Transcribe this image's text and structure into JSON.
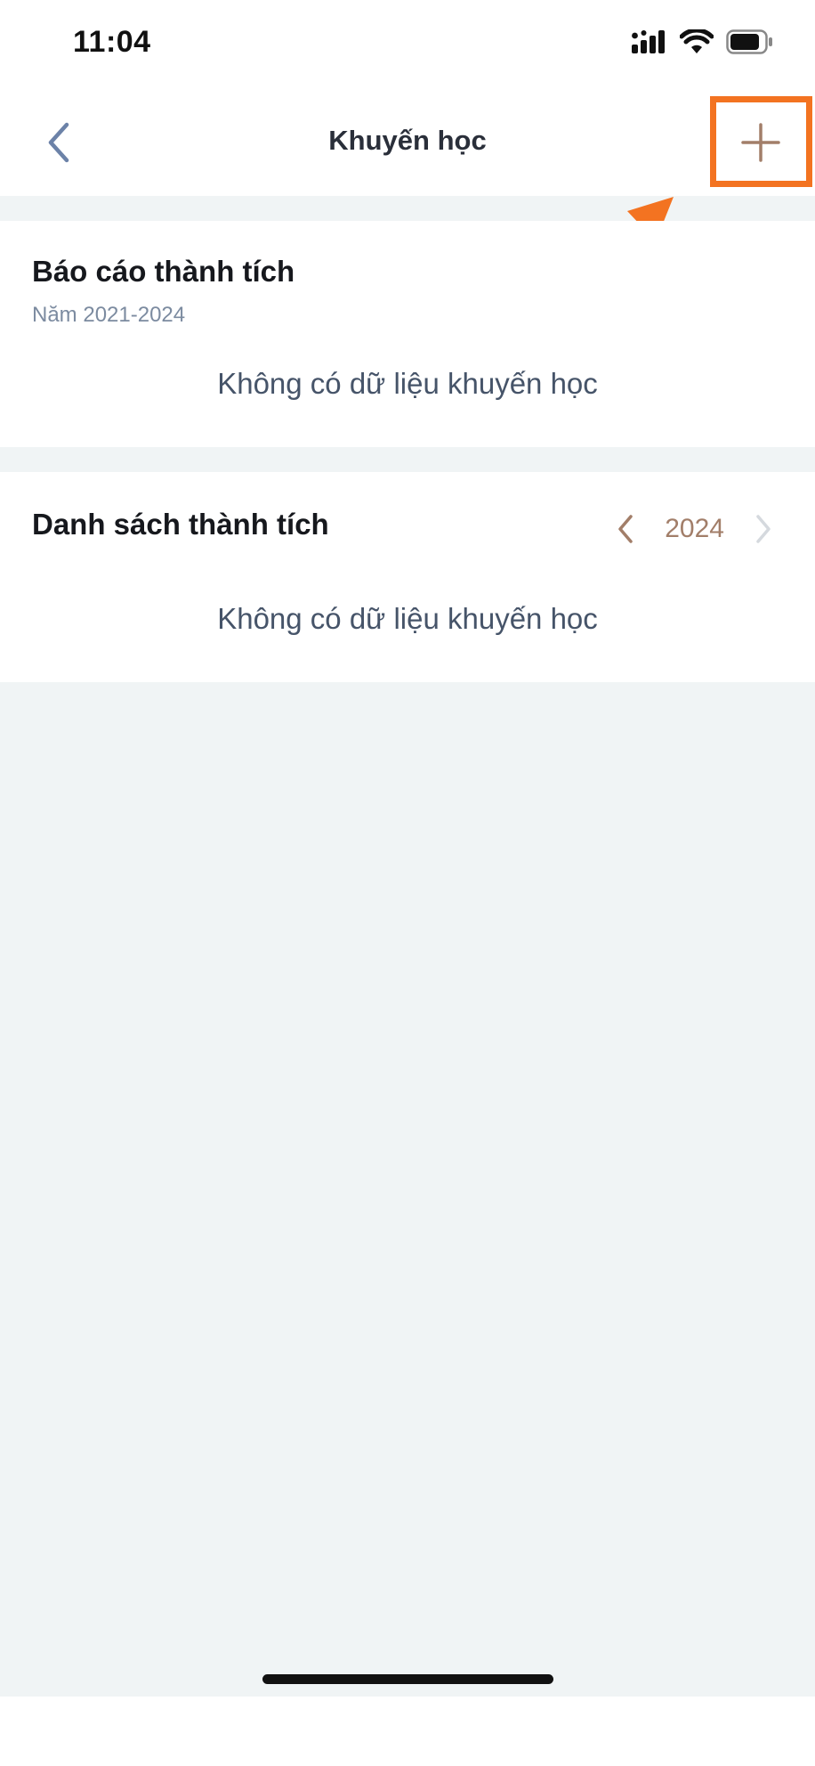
{
  "status_bar": {
    "time": "11:04",
    "icons": [
      "cellular-signal-icon",
      "wifi-icon",
      "battery-icon"
    ]
  },
  "nav": {
    "title": "Khuyến học",
    "back_icon": "chevron-left-icon",
    "add_icon": "plus-icon"
  },
  "report_section": {
    "title": "Báo cáo thành tích",
    "subtitle": "Năm 2021-2024",
    "empty_message": "Không có dữ liệu khuyến học"
  },
  "list_section": {
    "title": "Danh sách thành tích",
    "year": "2024",
    "empty_message": "Không có dữ liệu khuyến học"
  },
  "colors": {
    "accent": "#A27E69",
    "annotation": "#F37321",
    "background": "#F0F4F5",
    "back_icon": "#6C82A8"
  }
}
